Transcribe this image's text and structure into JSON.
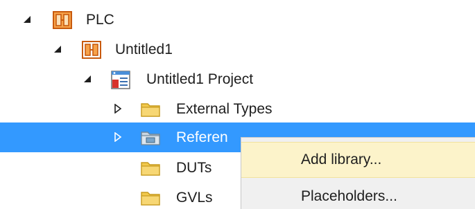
{
  "tree": {
    "nodes": [
      {
        "label": "PLC",
        "icon": "plc-icon",
        "expanded": true,
        "selected": false
      },
      {
        "label": "Untitled1",
        "icon": "plc-project-icon",
        "expanded": true,
        "selected": false
      },
      {
        "label": "Untitled1 Project",
        "icon": "project-file-icon",
        "expanded": true,
        "selected": false
      },
      {
        "label": "External Types",
        "icon": "folder-icon",
        "expanded": false,
        "selected": false
      },
      {
        "label": "Referen",
        "icon": "references-folder-icon",
        "expanded": false,
        "selected": true
      },
      {
        "label": "DUTs",
        "icon": "folder-icon",
        "selected": false
      },
      {
        "label": "GVLs",
        "icon": "folder-icon",
        "selected": false
      }
    ]
  },
  "context_menu": {
    "items": [
      {
        "label": "Add library...",
        "highlighted": true
      },
      {
        "label": "Placeholders...",
        "highlighted": false
      }
    ]
  },
  "colors": {
    "selection": "#3399ff",
    "menu_background": "#f0f0f0",
    "menu_highlight": "#fcf3ca",
    "plc_orange": "#e8791e",
    "folder_yellow": "#f2c94c"
  }
}
